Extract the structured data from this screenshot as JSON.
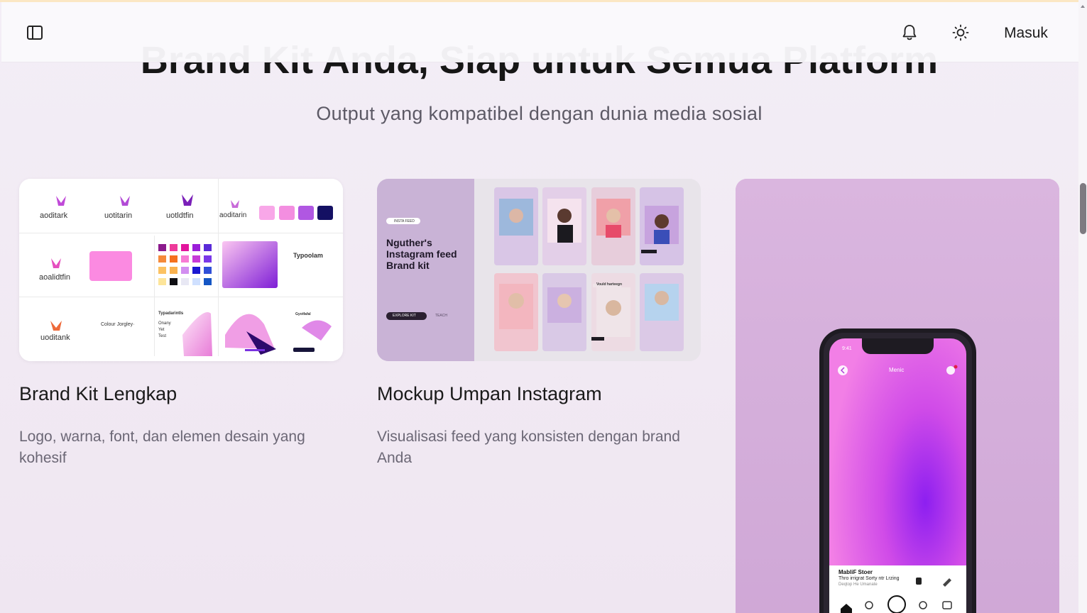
{
  "nav": {
    "login_label": "Masuk",
    "icons": [
      "sidebar-toggle-icon",
      "bell-icon",
      "sun-icon"
    ]
  },
  "hero": {
    "headline": "Brand Kit Anda, Siap untuk Semua Platform",
    "subtitle": "Output yang kompatibel dengan dunia media sosial"
  },
  "cards": [
    {
      "title": "Brand Kit Lengkap",
      "description": "Logo, warna, font, dan elemen desain yang kohesif",
      "image": {
        "logos": [
          "aoditark",
          "uotitarin",
          "uotldtfin",
          "aoditarin"
        ],
        "logo_main": "aoalidtfin",
        "logo_bottom": "uoditank",
        "typography_word": "Typoolam",
        "colour_caption": "Colour Jorgley·",
        "type_sample": "Typadarintls",
        "type_lines": [
          "Onany",
          "Yet",
          "Test"
        ],
        "footer_word": "Gyotfafal"
      }
    },
    {
      "title": "Mockup Umpan Instagram",
      "description": "Visualisasi feed yang konsisten dengan brand Anda",
      "image": {
        "pill": "INSTA FEED",
        "heading": "Nguther's Instagram feed Brand kit",
        "button": "EXPLORE KIT",
        "link": "TEACH",
        "post_caption": "Vould harteegn"
      }
    },
    {
      "title": "",
      "description": "",
      "image": {
        "status_time": "9:41",
        "screen_title": "Menic",
        "caption_title": "MabliF Stoer",
        "caption_line1": "Thro irrigrat Sorty ntr Lrzing",
        "caption_line2": "Deqtop He Umanate"
      }
    }
  ],
  "colors": {
    "accent_pink": "#f38ee0",
    "accent_purple": "#9b34e6",
    "deep_navy": "#141063"
  }
}
